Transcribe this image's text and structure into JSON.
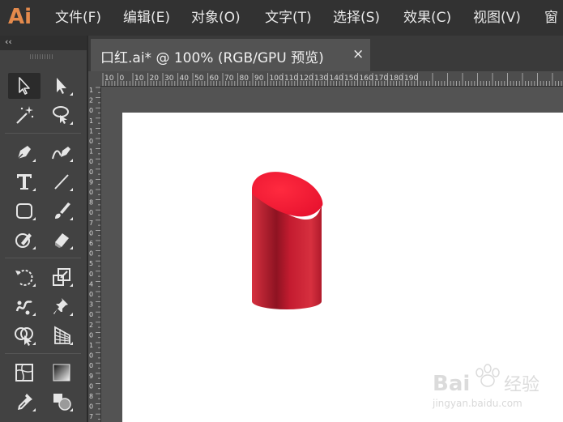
{
  "app": {
    "logo_text": "Ai"
  },
  "menu": {
    "items": [
      "文件(F)",
      "编辑(E)",
      "对象(O)",
      "文字(T)",
      "选择(S)",
      "效果(C)",
      "视图(V)",
      "窗"
    ]
  },
  "toolbox": {
    "collapse_label": "‹‹"
  },
  "document": {
    "tab_title": "口红.ai* @ 100% (RGB/GPU 预览)",
    "close_label": "×"
  },
  "ruler": {
    "h_labels": [
      "10",
      "0",
      "10",
      "20",
      "30",
      "40",
      "50",
      "60",
      "70",
      "80",
      "90",
      "100",
      "110",
      "120",
      "130",
      "140",
      "150",
      "160",
      "170",
      "180",
      "190"
    ],
    "v_labels": [
      "1",
      "2",
      "0",
      "1",
      "1",
      "0",
      "1",
      "0",
      "0",
      "9",
      "0",
      "8",
      "0",
      "7",
      "0",
      "6",
      "0",
      "5",
      "0",
      "4",
      "0",
      "3",
      "0",
      "2",
      "0",
      "1",
      "0",
      "0",
      "9",
      "0",
      "8",
      "0",
      "7"
    ]
  },
  "artwork": {
    "lipstick_top_color": "#e8132f",
    "lipstick_body_dark": "#8e1322",
    "lipstick_body_light": "#d6303f"
  },
  "watermark": {
    "brand": "Bai",
    "brand_suffix": "经验",
    "url": "jingyan.baidu.com"
  }
}
